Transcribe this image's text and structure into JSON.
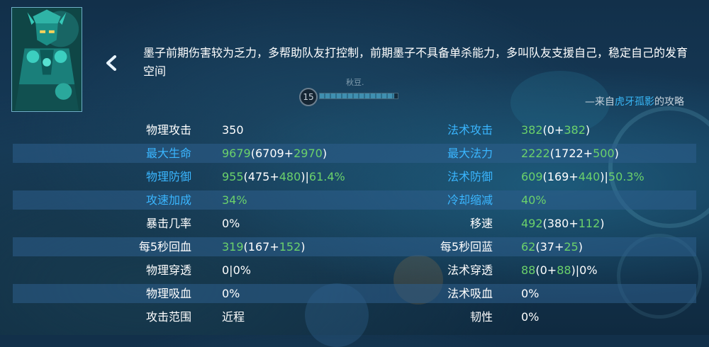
{
  "hero": {
    "portrait_icon": "hero-portrait-mozi",
    "description": "墨子前期伤害较为乏力，多帮助队友打控制，前期墨子不具备单杀能力，多叫队友支援自己，稳定自己的发育空间",
    "source_prefix": "—来自",
    "source_author": "虎牙孤影",
    "source_suffix": "的攻略"
  },
  "overlay": {
    "level": "15",
    "player_name": "秋豆.",
    "level_progress": 0.95
  },
  "colors": {
    "accent_label": "#3ab6ff",
    "bonus_value": "#6bd16b",
    "row_shade": "#2d5f8c"
  },
  "stats": {
    "left": [
      {
        "label": "物理攻击",
        "label_color": "white",
        "value": [
          {
            "t": "350",
            "c": "white"
          }
        ]
      },
      {
        "label": "最大生命",
        "label_color": "blue",
        "value": [
          {
            "t": "9679",
            "c": "green"
          },
          {
            "t": "(6709+",
            "c": "white"
          },
          {
            "t": "2970",
            "c": "green"
          },
          {
            "t": ")",
            "c": "white"
          }
        ]
      },
      {
        "label": "物理防御",
        "label_color": "blue",
        "value": [
          {
            "t": "955",
            "c": "green"
          },
          {
            "t": "(475+",
            "c": "white"
          },
          {
            "t": "480",
            "c": "green"
          },
          {
            "t": ")|",
            "c": "white"
          },
          {
            "t": "61.4%",
            "c": "green"
          }
        ]
      },
      {
        "label": "攻速加成",
        "label_color": "blue",
        "value": [
          {
            "t": "34%",
            "c": "green"
          }
        ]
      },
      {
        "label": "暴击几率",
        "label_color": "white",
        "value": [
          {
            "t": "0%",
            "c": "white"
          }
        ]
      },
      {
        "label": "每5秒回血",
        "label_color": "white",
        "value": [
          {
            "t": "319",
            "c": "green"
          },
          {
            "t": "(167+",
            "c": "white"
          },
          {
            "t": "152",
            "c": "green"
          },
          {
            "t": ")",
            "c": "white"
          }
        ]
      },
      {
        "label": "物理穿透",
        "label_color": "white",
        "value": [
          {
            "t": "0|0%",
            "c": "white"
          }
        ]
      },
      {
        "label": "物理吸血",
        "label_color": "white",
        "value": [
          {
            "t": "0%",
            "c": "white"
          }
        ]
      },
      {
        "label": "攻击范围",
        "label_color": "white",
        "value": [
          {
            "t": "近程",
            "c": "white"
          }
        ]
      }
    ],
    "right": [
      {
        "label": "法术攻击",
        "label_color": "blue",
        "value": [
          {
            "t": "382",
            "c": "green"
          },
          {
            "t": "(0+",
            "c": "white"
          },
          {
            "t": "382",
            "c": "green"
          },
          {
            "t": ")",
            "c": "white"
          }
        ]
      },
      {
        "label": "最大法力",
        "label_color": "blue",
        "value": [
          {
            "t": "2222",
            "c": "green"
          },
          {
            "t": "(1722+",
            "c": "white"
          },
          {
            "t": "500",
            "c": "green"
          },
          {
            "t": ")",
            "c": "white"
          }
        ]
      },
      {
        "label": "法术防御",
        "label_color": "blue",
        "value": [
          {
            "t": "609",
            "c": "green"
          },
          {
            "t": "(169+",
            "c": "white"
          },
          {
            "t": "440",
            "c": "green"
          },
          {
            "t": ")|",
            "c": "white"
          },
          {
            "t": "50.3%",
            "c": "green"
          }
        ]
      },
      {
        "label": "冷却缩减",
        "label_color": "blue",
        "value": [
          {
            "t": "40%",
            "c": "green"
          }
        ]
      },
      {
        "label": "移速",
        "label_color": "white",
        "value": [
          {
            "t": "492",
            "c": "green"
          },
          {
            "t": "(380+",
            "c": "white"
          },
          {
            "t": "112",
            "c": "green"
          },
          {
            "t": ")",
            "c": "white"
          }
        ]
      },
      {
        "label": "每5秒回蓝",
        "label_color": "white",
        "value": [
          {
            "t": "62",
            "c": "green"
          },
          {
            "t": "(37+",
            "c": "white"
          },
          {
            "t": "25",
            "c": "green"
          },
          {
            "t": ")",
            "c": "white"
          }
        ]
      },
      {
        "label": "法术穿透",
        "label_color": "white",
        "value": [
          {
            "t": "88",
            "c": "green"
          },
          {
            "t": "(0+",
            "c": "white"
          },
          {
            "t": "88",
            "c": "green"
          },
          {
            "t": ")|0%",
            "c": "white"
          }
        ]
      },
      {
        "label": "法术吸血",
        "label_color": "white",
        "value": [
          {
            "t": "0%",
            "c": "white"
          }
        ]
      },
      {
        "label": "韧性",
        "label_color": "white",
        "value": [
          {
            "t": "0%",
            "c": "white"
          }
        ]
      }
    ]
  }
}
